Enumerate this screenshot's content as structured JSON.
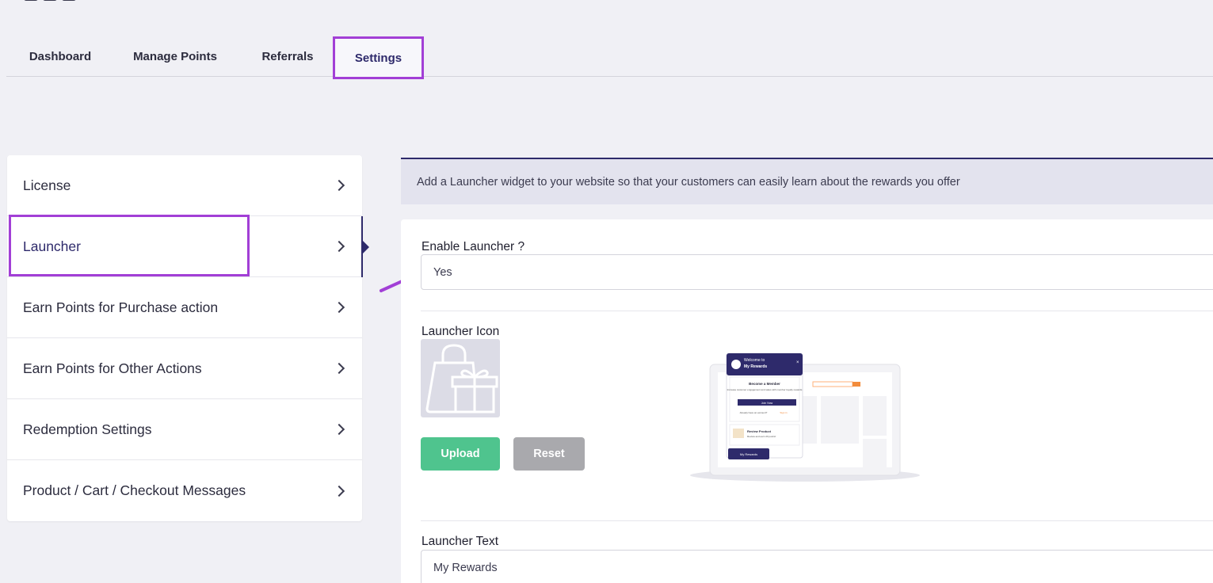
{
  "tabs": [
    "Dashboard",
    "Manage Points",
    "Referrals",
    "Settings"
  ],
  "sidebar": {
    "items": [
      {
        "label": "License"
      },
      {
        "label": "Launcher"
      },
      {
        "label": "Earn Points for Purchase action"
      },
      {
        "label": "Earn Points for Other Actions"
      },
      {
        "label": "Redemption Settings"
      },
      {
        "label": "Product / Cart / Checkout Messages"
      }
    ]
  },
  "info": {
    "text": "Add a Launcher widget to your website so that your customers can easily learn about the rewards you offer"
  },
  "form": {
    "enable_label": "Enable Launcher ?",
    "enable_value": "Yes",
    "icon_label": "Launcher Icon",
    "upload_label": "Upload",
    "reset_label": "Reset",
    "text_label": "Launcher Text",
    "text_value": "My Rewards"
  },
  "preview": {
    "header_small": "Welcome to",
    "header_title": "My Rewards",
    "member_title": "Become a Member",
    "member_desc": "Increase customer engagement and sales with member loyalty rewards",
    "join_button": "Join Now",
    "signin_text": "Already have an account?",
    "signin_link": "Sign in",
    "review_title": "Review Product",
    "review_desc": "Review and earn 20 points!",
    "launcher_button": "My Rewards"
  },
  "colors": {
    "accent": "#2e2a6b",
    "highlight": "#a23fd6",
    "upload": "#4fc48e",
    "reset": "#a9a9ad"
  }
}
